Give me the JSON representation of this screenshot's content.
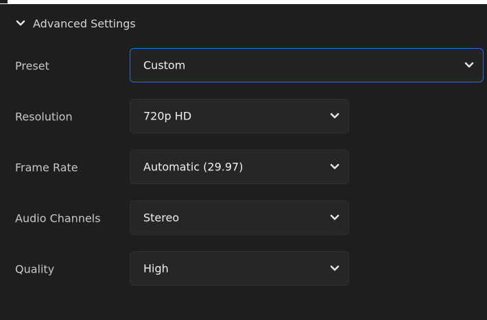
{
  "section": {
    "title": "Advanced Settings",
    "expanded_icon": "chevron-down-icon"
  },
  "settings": {
    "preset": {
      "label": "Preset",
      "value": "Custom",
      "focused": true
    },
    "resolution": {
      "label": "Resolution",
      "value": "720p HD"
    },
    "frame_rate": {
      "label": "Frame Rate",
      "value": "Automatic (29.97)"
    },
    "audio_channels": {
      "label": "Audio Channels",
      "value": "Stereo"
    },
    "quality": {
      "label": "Quality",
      "value": "High"
    }
  },
  "colors": {
    "background": "#1e1e1e",
    "field": "#262626",
    "focus_border": "#2a6fd8",
    "text": "#f0f0f0",
    "label": "#c8c8c8"
  }
}
